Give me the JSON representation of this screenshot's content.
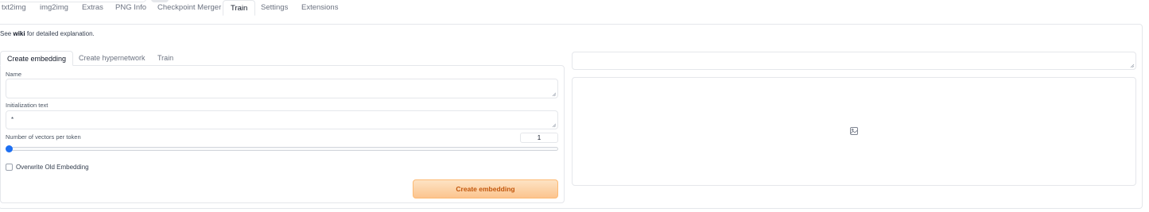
{
  "main_tabs": [
    "txt2img",
    "img2img",
    "Extras",
    "PNG Info",
    "Checkpoint Merger",
    "Train",
    "Settings",
    "Extensions"
  ],
  "active_main_tab": "Train",
  "info": {
    "prefix": "See ",
    "link": "wiki",
    "suffix": " for detailed explanation."
  },
  "sub_tabs": [
    "Create embedding",
    "Create hypernetwork",
    "Train"
  ],
  "active_sub_tab": "Create embedding",
  "form": {
    "name_label": "Name",
    "name_value": "",
    "init_text_label": "Initialization text",
    "init_text_value": "*",
    "vectors_label": "Number of vectors per token",
    "vectors_value": "1",
    "vectors_slider_fraction": 0,
    "overwrite_label": "Overwrite Old Embedding",
    "overwrite_checked": false,
    "submit_label": "Create embedding"
  },
  "output": {
    "text_value": "",
    "gallery_icon": "image-icon"
  },
  "colors": {
    "accent": "#1d6ff2",
    "primary_button_text": "#c2570c",
    "primary_button_bg": "#fcc48e"
  }
}
